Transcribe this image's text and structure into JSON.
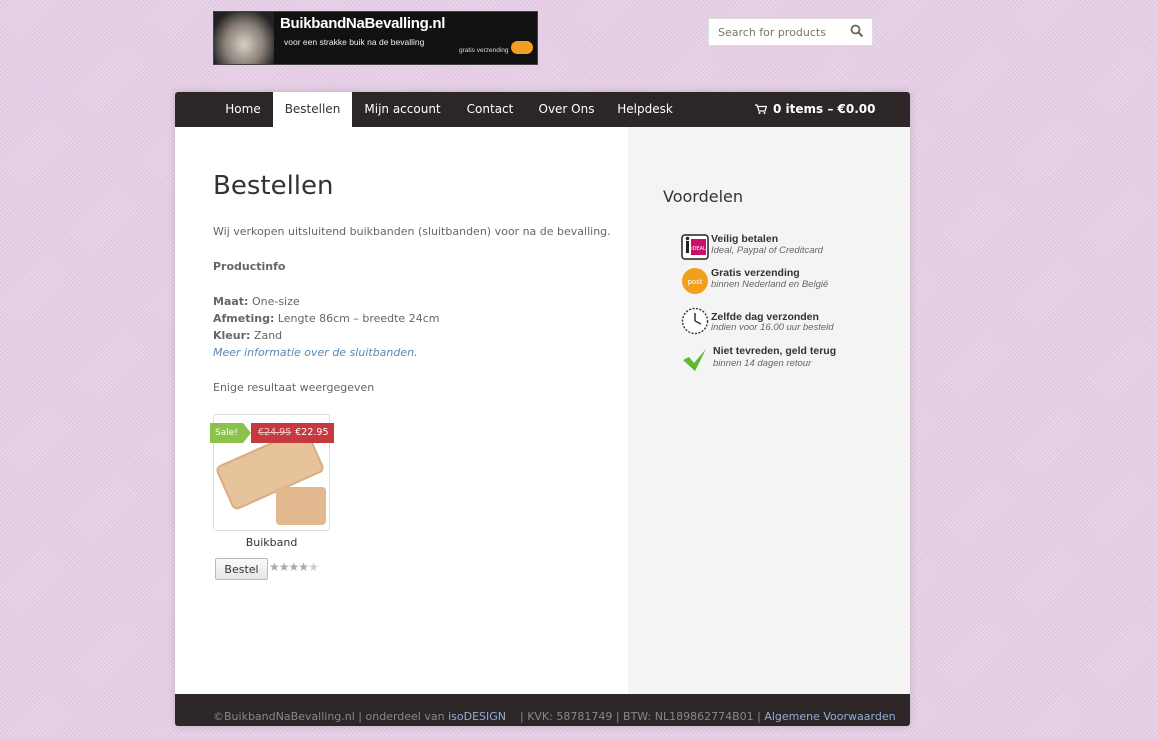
{
  "logo": {
    "title": "BuikbandNaBevalling.nl",
    "tagline": "voor een strakke buik na de bevalling",
    "shipping": "gratis verzending"
  },
  "search": {
    "placeholder": "Search for products"
  },
  "nav": {
    "items": [
      {
        "label": "Home"
      },
      {
        "label": "Bestellen"
      },
      {
        "label": "Mijn account"
      },
      {
        "label": "Contact"
      },
      {
        "label": "Over Ons"
      },
      {
        "label": "Helpdesk"
      }
    ],
    "active": "Bestellen",
    "cart": "0 items – €0.00"
  },
  "page": {
    "title": "Bestellen",
    "intro": "Wij verkopen uitsluitend buikbanden (sluitbanden) voor na de bevalling.",
    "productinfo_heading": "Productinfo",
    "maat_label": "Maat:",
    "maat_value": " One-size",
    "afmeting_label": "Afmeting:",
    "afmeting_value": " Lengte 86cm – breedte 24cm",
    "kleur_label": "Kleur:",
    "kleur_value": " Zand",
    "more_link": "Meer informatie over de sluitbanden.",
    "result_count": "Enige resultaat weergegeven"
  },
  "product": {
    "name": "Buikband",
    "sale_label": "Sale!",
    "old_price": "€24.95",
    "price": "€22.95",
    "button": "Bestel",
    "rating": 4
  },
  "sidebar": {
    "title": "Voordelen",
    "benefits": [
      {
        "title": "Veilig betalen",
        "subtitle": "Ideal, Paypal of Creditcard",
        "icon": "ideal-icon"
      },
      {
        "title": "Gratis verzending",
        "subtitle": "binnen Nederland en België",
        "icon": "postnl-icon"
      },
      {
        "title": "Zelfde dag verzonden",
        "subtitle": "indien voor 16.00 uur besteld",
        "icon": "clock-icon"
      },
      {
        "title": "Niet tevreden, geld terug",
        "subtitle": "binnen 14 dagen retour",
        "icon": "checkmark-icon"
      }
    ]
  },
  "footer": {
    "copyright": "©BuikbandNaBevalling.nl | onderdeel van ",
    "isodesign": "isoDESIGN",
    "kvk": "    | KVK: 58781749 | BTW: NL189862774B01 | ",
    "voorwaarden": "Algemene Voorwaarden"
  },
  "colors": {
    "nav_bg": "#2c2627",
    "sale_green": "#8bc34a",
    "sale_red": "#c63a3f",
    "link": "#5b86b4"
  }
}
